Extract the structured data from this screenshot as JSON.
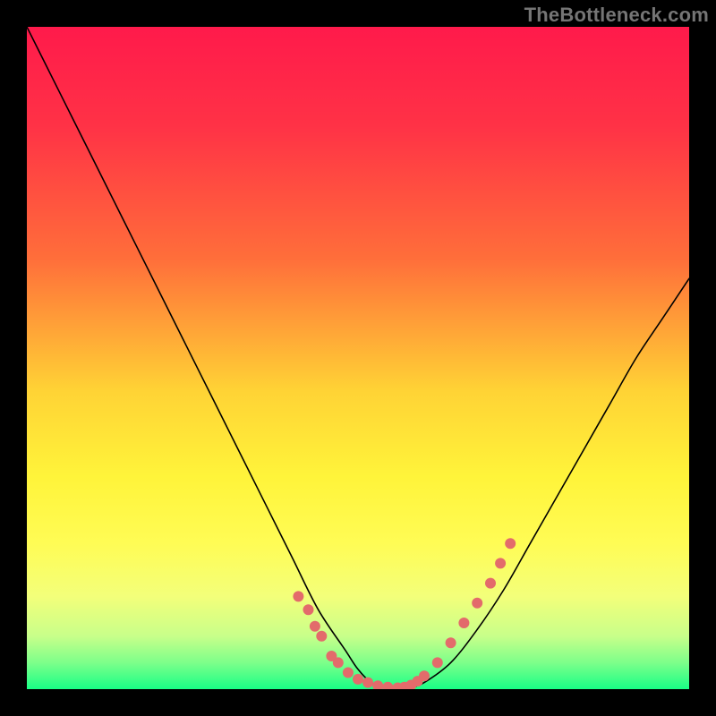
{
  "watermark": "TheBottleneck.com",
  "chart_data": {
    "type": "line",
    "title": "",
    "xlabel": "",
    "ylabel": "",
    "xlim": [
      0,
      100
    ],
    "ylim": [
      0,
      100
    ],
    "grid": false,
    "background_gradient": {
      "stops": [
        {
          "offset": 0.0,
          "color": "#ff1a4b"
        },
        {
          "offset": 0.15,
          "color": "#ff3246"
        },
        {
          "offset": 0.35,
          "color": "#ff6e3a"
        },
        {
          "offset": 0.55,
          "color": "#ffd335"
        },
        {
          "offset": 0.68,
          "color": "#fff43a"
        },
        {
          "offset": 0.78,
          "color": "#fffc55"
        },
        {
          "offset": 0.86,
          "color": "#f3ff7a"
        },
        {
          "offset": 0.92,
          "color": "#c8ff8a"
        },
        {
          "offset": 0.96,
          "color": "#7dff8a"
        },
        {
          "offset": 1.0,
          "color": "#19ff86"
        }
      ]
    },
    "series": [
      {
        "name": "bottleneck-curve",
        "stroke": "#000000",
        "stroke_width": 1.6,
        "x": [
          0,
          4,
          8,
          12,
          16,
          20,
          24,
          28,
          32,
          36,
          40,
          44,
          48,
          50,
          52,
          54,
          56,
          58,
          60,
          64,
          68,
          72,
          76,
          80,
          84,
          88,
          92,
          96,
          100
        ],
        "y": [
          100,
          92,
          84,
          76,
          68,
          60,
          52,
          44,
          36,
          28,
          20,
          12,
          6,
          3,
          1,
          0.3,
          0,
          0.3,
          1,
          4,
          9,
          15,
          22,
          29,
          36,
          43,
          50,
          56,
          62
        ]
      }
    ],
    "scatter_overlay": {
      "name": "highlight-dots",
      "color": "#e36b6b",
      "radius": 6,
      "points": [
        {
          "x": 41,
          "y": 14
        },
        {
          "x": 42.5,
          "y": 12
        },
        {
          "x": 43.5,
          "y": 9.5
        },
        {
          "x": 44.5,
          "y": 8
        },
        {
          "x": 46,
          "y": 5
        },
        {
          "x": 47,
          "y": 4
        },
        {
          "x": 48.5,
          "y": 2.5
        },
        {
          "x": 50,
          "y": 1.5
        },
        {
          "x": 51.5,
          "y": 1
        },
        {
          "x": 53,
          "y": 0.5
        },
        {
          "x": 54.5,
          "y": 0.3
        },
        {
          "x": 56,
          "y": 0.2
        },
        {
          "x": 57,
          "y": 0.3
        },
        {
          "x": 58,
          "y": 0.6
        },
        {
          "x": 59,
          "y": 1.2
        },
        {
          "x": 60,
          "y": 2
        },
        {
          "x": 62,
          "y": 4
        },
        {
          "x": 64,
          "y": 7
        },
        {
          "x": 66,
          "y": 10
        },
        {
          "x": 68,
          "y": 13
        },
        {
          "x": 70,
          "y": 16
        },
        {
          "x": 71.5,
          "y": 19
        },
        {
          "x": 73,
          "y": 22
        }
      ]
    }
  }
}
